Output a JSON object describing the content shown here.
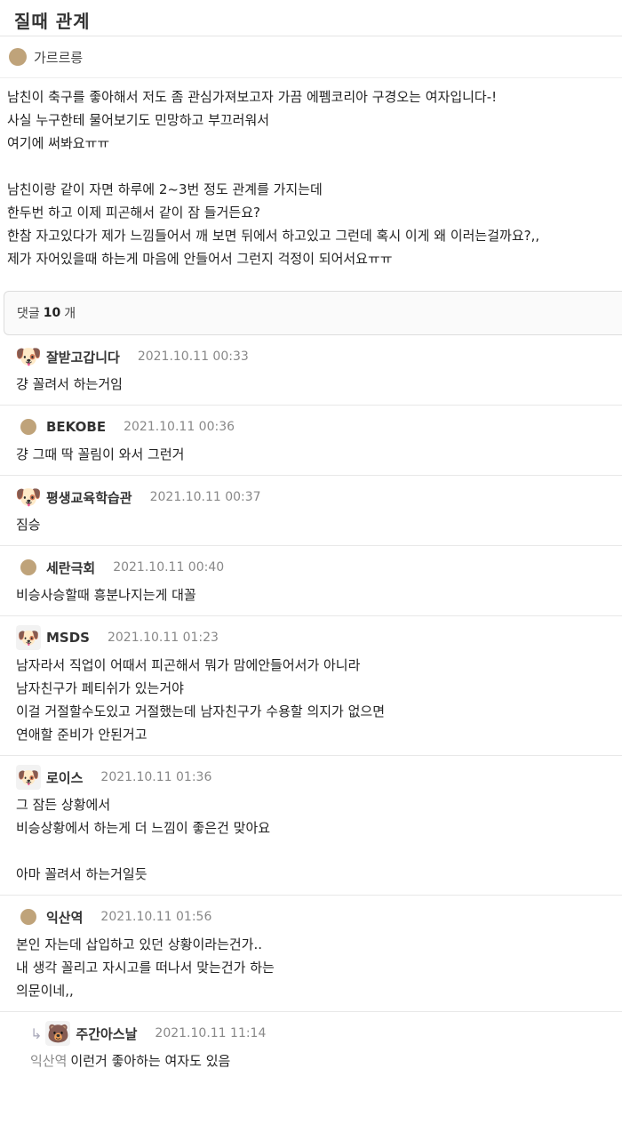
{
  "post": {
    "title": "질때 관계",
    "author": "가르르릉",
    "lines": [
      "남친이 축구를 좋아해서 저도 좀 관심가져보고자 가끔 에펨코리아 구경오는 여자입니다-!",
      "사실 누구한테 물어보기도 민망하고 부끄러워서",
      "여기에 써봐요ㅠㅠ",
      "",
      "남친이랑 같이 자면 하루에 2~3번 정도 관계를 가지는데",
      "한두번 하고 이제 피곤해서 같이 잠 들거든요?",
      "한참 자고있다가 제가 느낌들어서 깨 보면 뒤에서 하고있고 그런데 혹시 이게 왜 이러는걸까요?,,",
      "제가 자어있을때 하는게 마음에 안들어서 그런지 걱정이 되어서요ㅠㅠ"
    ]
  },
  "comments_header": {
    "prefix": "댓글",
    "count": "10",
    "suffix": "개"
  },
  "comments": [
    {
      "name": "잘받고갑니다",
      "date": "2021.10.11 00:33",
      "avatar": "dog",
      "lines": [
        "걍 꼴려서 하는거임"
      ]
    },
    {
      "name": "BEKOBE",
      "date": "2021.10.11 00:36",
      "avatar": "dot",
      "lines": [
        "걍 그때 딱 꼴림이 와서 그런거"
      ]
    },
    {
      "name": "평생교육학습관",
      "date": "2021.10.11 00:37",
      "avatar": "dog2",
      "lines": [
        "짐승"
      ]
    },
    {
      "name": "세란극회",
      "date": "2021.10.11 00:40",
      "avatar": "dot",
      "lines": [
        "비승사승할때 흥분나지는게 대꼴"
      ]
    },
    {
      "name": "MSDS",
      "date": "2021.10.11 01:23",
      "avatar": "white",
      "lines": [
        "남자라서 직업이 어때서 피곤해서 뭐가 맘에안들어서가 아니라",
        "남자친구가 페티쉬가 있는거야",
        "이걸 거절할수도있고 거절했는데 남자친구가 수용할 의지가 없으면",
        "연애할 준비가 안된거고"
      ]
    },
    {
      "name": "로이스",
      "date": "2021.10.11 01:36",
      "avatar": "white",
      "lines": [
        "그 잠든 상황에서",
        "비승상황에서 하는게 더 느낌이 좋은건 맞아요",
        "",
        "아마 꼴려서 하는거일듯"
      ]
    },
    {
      "name": "익산역",
      "date": "2021.10.11 01:56",
      "avatar": "dot",
      "lines": [
        "본인 자는데 삽입하고 있던 상황이라는건가..",
        "내 생각 꼴리고 자시고를 떠나서 맞는건가 하는",
        "의문이네,,"
      ]
    }
  ],
  "reply": {
    "name": "주간아스날",
    "date": "2021.10.11 11:14",
    "mention": "익산역",
    "text": "이런거 좋아하는 여자도 있음"
  }
}
